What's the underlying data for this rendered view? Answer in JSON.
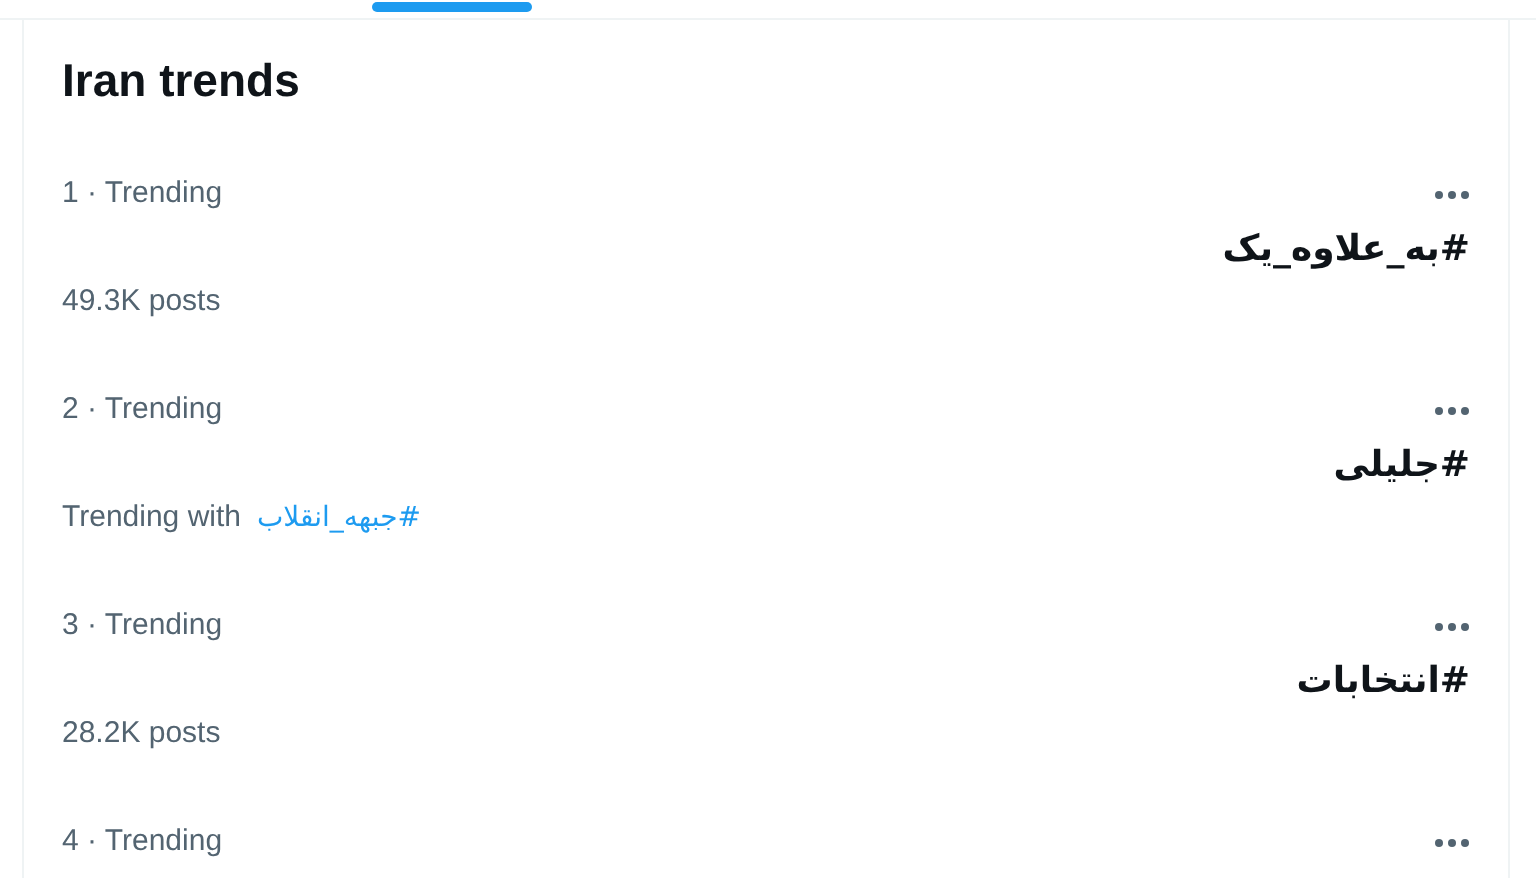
{
  "title": "Iran trends",
  "trends": [
    {
      "meta": "1 · Trending",
      "hashtag": "#به_علاوه_یک",
      "posts": "49.3K posts"
    },
    {
      "meta": "2 · Trending",
      "hashtag": "#جلیلی",
      "trending_with_label": "Trending with",
      "trending_with": "#جبهه_انقلاب"
    },
    {
      "meta": "3 · Trending",
      "hashtag": "#انتخابات",
      "posts": "28.2K posts"
    },
    {
      "meta": "4 · Trending"
    }
  ]
}
